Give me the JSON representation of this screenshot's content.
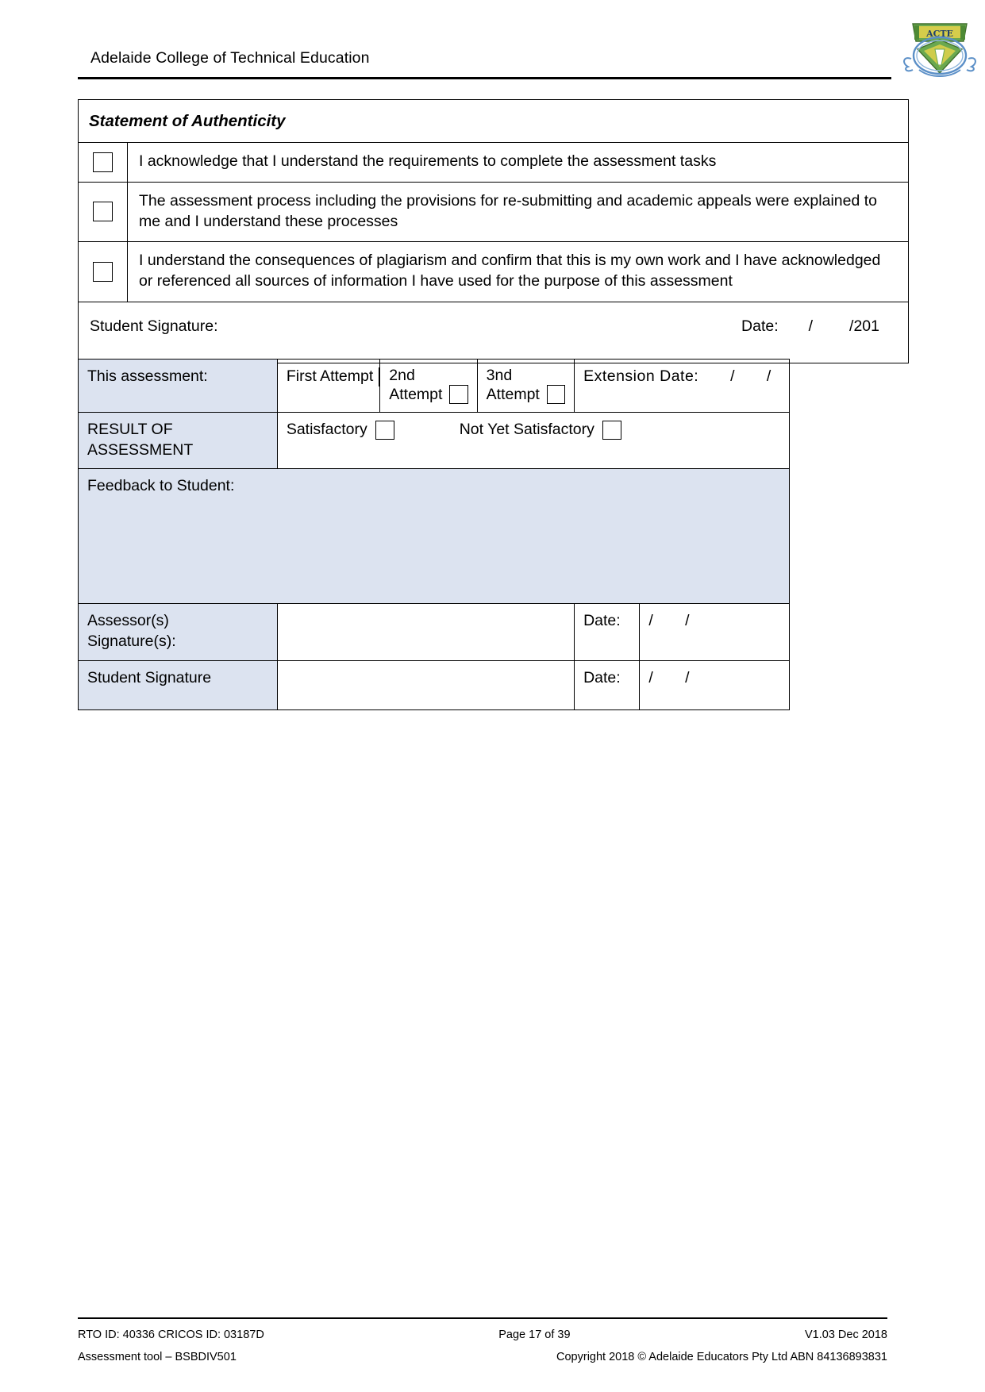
{
  "header": {
    "institution": "Adelaide College of Technical Education",
    "logo": {
      "name": "college-crest-logo",
      "alt": "Adelaide College of Technical Education crest",
      "colors": {
        "shield_green": "#5b9a3e",
        "shield_yellow": "#e8d44a",
        "wreath_blue": "#5b8fc7",
        "outline": "#3f6f2c"
      }
    }
  },
  "authenticity": {
    "title": "Statement of Authenticity",
    "statements": [
      "I acknowledge that I understand the requirements to complete the assessment tasks",
      "The assessment process including the provisions for re-submitting and academic appeals were explained to me and I understand these processes",
      "I understand the consequences of plagiarism and confirm that this is my own work and I have acknowledged or referenced all sources of information I have used for the purpose of this assessment"
    ],
    "signature_label": "Student Signature:",
    "date_label": "Date:",
    "date_slash_1": "/",
    "date_slash_2": "/201"
  },
  "result_table": {
    "fill_color": "#dce3f0",
    "assessment_row": {
      "label": "This assessment:",
      "first_attempt_label": "First Attempt",
      "second_attempt_label_line1": "2nd",
      "second_attempt_label_line2": "Attempt",
      "third_attempt_label_line1": "3nd",
      "third_attempt_label_line2": "Attempt",
      "extension_label": "Extension Date:",
      "extension_slash_1": "/",
      "extension_slash_2": "/"
    },
    "result_row": {
      "label_line1": "RESULT OF",
      "label_line2": "ASSESSMENT",
      "satisfactory_label": "Satisfactory",
      "not_yet_satisfactory_label": "Not Yet Satisfactory"
    },
    "feedback_row": {
      "label": "Feedback to Student:",
      "value": ""
    },
    "assessor_row": {
      "label_line1": "Assessor(s)",
      "label_line2": "Signature(s):",
      "signature_value": "",
      "date_label": "Date:",
      "date_slash_1": "/",
      "date_slash_2": "/"
    },
    "student_row": {
      "label": "Student Signature",
      "signature_value": "",
      "date_label": "Date:",
      "date_slash_1": "/",
      "date_slash_2": "/"
    }
  },
  "footer": {
    "rto": "RTO ID: 40336 CRICOS ID: 03187D",
    "page": "Page 17 of 39",
    "version": "V1.03 Dec 2018",
    "tool": "Assessment tool – BSBDIV501",
    "copyright": "Copyright 2018 © Adelaide Educators Pty Ltd ABN 84136893831"
  }
}
